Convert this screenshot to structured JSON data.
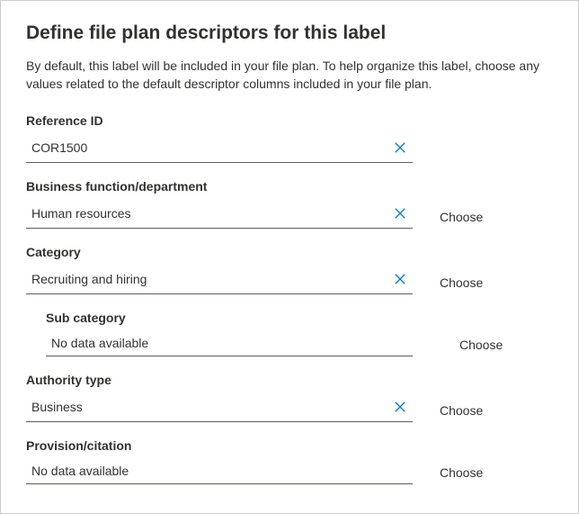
{
  "header": {
    "title": "Define file plan descriptors for this label",
    "description": "By default, this label will be included in your file plan. To help organize this label, choose any values related to the default descriptor columns included in your file plan."
  },
  "fields": {
    "reference_id": {
      "label": "Reference ID",
      "value": "COR1500"
    },
    "business_function": {
      "label": "Business function/department",
      "value": "Human resources",
      "choose": "Choose"
    },
    "category": {
      "label": "Category",
      "value": "Recruiting and hiring",
      "choose": "Choose"
    },
    "sub_category": {
      "label": "Sub category",
      "value": "No data available",
      "choose": "Choose"
    },
    "authority_type": {
      "label": "Authority type",
      "value": "Business",
      "choose": "Choose"
    },
    "provision_citation": {
      "label": "Provision/citation",
      "value": "No data available",
      "choose": "Choose"
    }
  }
}
